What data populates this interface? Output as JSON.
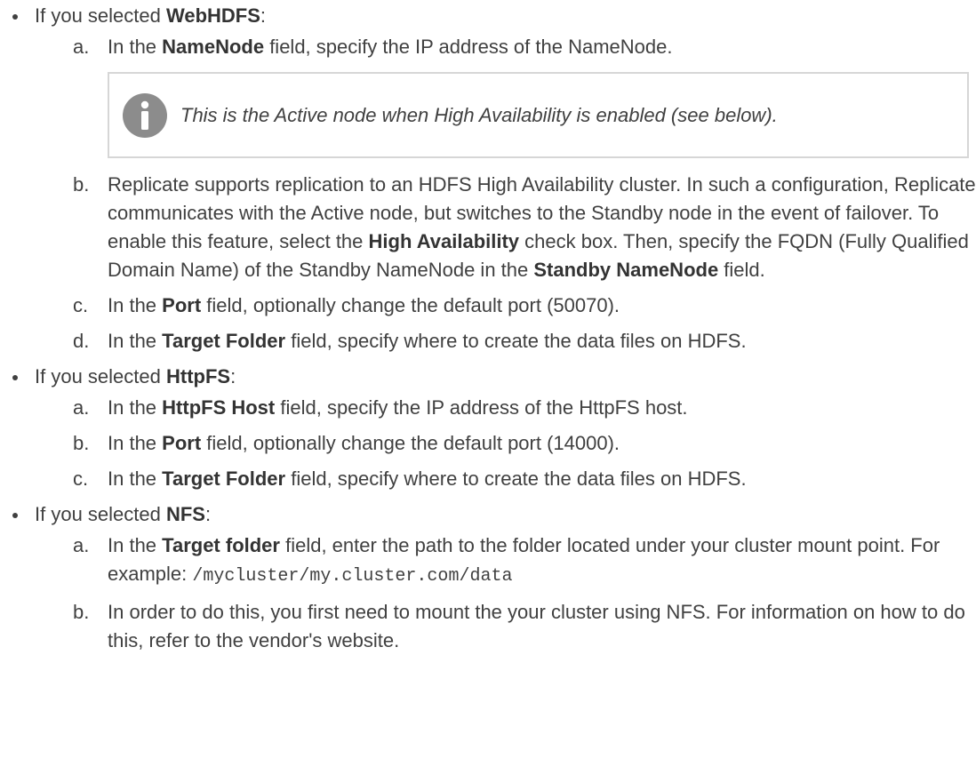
{
  "sections": [
    {
      "pre": "If you selected ",
      "bold": "WebHDFS",
      "post": ":",
      "steps": [
        {
          "marker": "a.",
          "html": "In the <b>NameNode</b> field, specify the IP address of the NameNode."
        },
        {
          "marker": "b.",
          "html": "Replicate supports replication to an HDFS High Availability cluster. In such a configuration, Replicate communicates with the Active node, but switches to the Standby node in the event of failover. To enable this feature, select the <b>High Availability</b> check box. Then, specify the FQDN (Fully Qualified Domain Name) of the Standby NameNode in the <b>Standby NameNode</b> field."
        },
        {
          "marker": "c.",
          "html": "In the <b>Port</b> field, optionally change the default port (50070)."
        },
        {
          "marker": "d.",
          "html": "In the <b>Target Folder</b> field, specify where to create the data files on HDFS."
        }
      ]
    },
    {
      "pre": "If you selected ",
      "bold": "HttpFS",
      "post": ":",
      "steps": [
        {
          "marker": "a.",
          "html": "In the <b>HttpFS Host</b> field, specify the IP address of the HttpFS host."
        },
        {
          "marker": "b.",
          "html": "In the <b>Port</b> field, optionally change the default port (14000)."
        },
        {
          "marker": "c.",
          "html": "In the <b>Target Folder</b> field, specify where to create the data files on HDFS."
        }
      ]
    },
    {
      "pre": "If you selected ",
      "bold": "NFS",
      "post": ":",
      "steps": [
        {
          "marker": "a.",
          "html": "In the <b>Target folder</b> field, enter the path to the folder located under your cluster mount point. For example: <span class=\"mono\">/mycluster/my.cluster.com/data</span>"
        },
        {
          "marker": "b.",
          "html": "In order to do this, you first need to mount the your cluster using NFS. For information on how to do this, refer to the vendor's website."
        }
      ]
    }
  ],
  "note": {
    "icon": "info-icon",
    "text": "This is the Active node when High Availability is enabled (see below).",
    "icon_color": "#8c8c8c",
    "border_color": "#d6d6d6"
  }
}
